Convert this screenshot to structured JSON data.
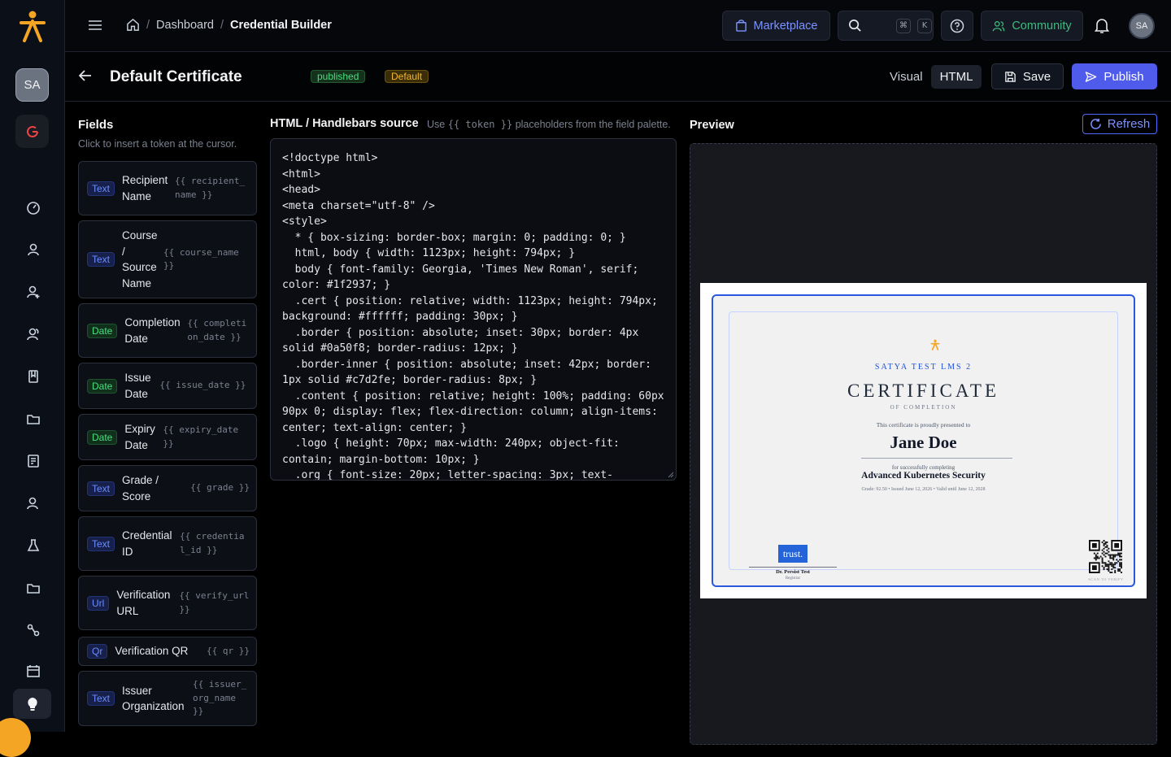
{
  "rail": {
    "avatar_initials": "SA",
    "nav_icons": [
      "dashboard-icon",
      "user-icon",
      "user-add-icon",
      "users-icon",
      "book-icon",
      "folder-icon",
      "report-icon",
      "group-icon",
      "flask-icon",
      "folder-icon",
      "workflow-icon",
      "calendar-icon",
      "lightbulb-icon"
    ]
  },
  "topbar": {
    "breadcrumbs": [
      "Dashboard",
      "Credential Builder"
    ],
    "marketplace_label": "Marketplace",
    "search_shortcut": [
      "⌘",
      "K"
    ],
    "community_label": "Community",
    "user_initials": "SA"
  },
  "header": {
    "title": "Default Certificate",
    "status_badge": "published",
    "default_badge": "Default",
    "visual_tab": "Visual",
    "html_tab": "HTML",
    "save_label": "Save",
    "publish_label": "Publish"
  },
  "fields_panel": {
    "title": "Fields",
    "subtitle": "Click to insert a token at the cursor.",
    "items": [
      {
        "type": "Text",
        "label": "Recipient Name",
        "token": "{{ recipient_name }}"
      },
      {
        "type": "Text",
        "label": "Course / Source Name",
        "token": "{{ course_name }}"
      },
      {
        "type": "Date",
        "label": "Completion Date",
        "token": "{{ completion_date }}"
      },
      {
        "type": "Date",
        "label": "Issue Date",
        "token": "{{ issue_date }}"
      },
      {
        "type": "Date",
        "label": "Expiry Date",
        "token": "{{ expiry_date }}"
      },
      {
        "type": "Text",
        "label": "Grade / Score",
        "token": "{{ grade }}"
      },
      {
        "type": "Text",
        "label": "Credential ID",
        "token": "{{ credential_id }}"
      },
      {
        "type": "Url",
        "label": "Verification URL",
        "token": "{{ verify_url }}"
      },
      {
        "type": "Qr",
        "label": "Verification QR",
        "token": "{{ qr }}"
      },
      {
        "type": "Text",
        "label": "Issuer Organization",
        "token": "{{ issuer_org_name }}"
      }
    ]
  },
  "source_panel": {
    "title": "HTML / Handlebars source",
    "hint_prefix": "Use",
    "hint_token": "{{ token }}",
    "hint_suffix": "placeholders from the field palette.",
    "code": "<!doctype html>\n<html>\n<head>\n<meta charset=\"utf-8\" />\n<style>\n  * { box-sizing: border-box; margin: 0; padding: 0; }\n  html, body { width: 1123px; height: 794px; }\n  body { font-family: Georgia, 'Times New Roman', serif; color: #1f2937; }\n  .cert { position: relative; width: 1123px; height: 794px; background: #ffffff; padding: 30px; }\n  .border { position: absolute; inset: 30px; border: 4px solid #0a50f8; border-radius: 12px; }\n  .border-inner { position: absolute; inset: 42px; border: 1px solid #c7d2fe; border-radius: 8px; }\n  .content { position: relative; height: 100%; padding: 60px 90px 0; display: flex; flex-direction: column; align-items: center; text-align: center; }\n  .logo { height: 70px; max-width: 240px; object-fit: contain; margin-bottom: 10px; }\n  .org { font-size: 20px; letter-spacing: 3px; text-transform: uppercase; }"
  },
  "preview_panel": {
    "title": "Preview",
    "refresh_label": "Refresh",
    "certificate": {
      "org": "SATYA TEST LMS 2",
      "title": "CERTIFICATE",
      "subtitle": "OF COMPLETION",
      "presented": "This certificate is proudly presented to",
      "recipient": "Jane Doe",
      "for_text": "for successfully completing",
      "course": "Advanced Kubernetes Security",
      "meta": "Grade: 92.50  •  Issued June 12, 2026  •  Valid until June 12, 2028",
      "logo_text": "trust.",
      "signer_name": "Dr. Persist Test",
      "signer_role": "Registrar",
      "qr_caption": "SCAN TO VERIFY"
    }
  },
  "colors": {
    "accent": "#4f5bea",
    "brand": "#f5a524",
    "cert_border": "#2a59e0"
  }
}
